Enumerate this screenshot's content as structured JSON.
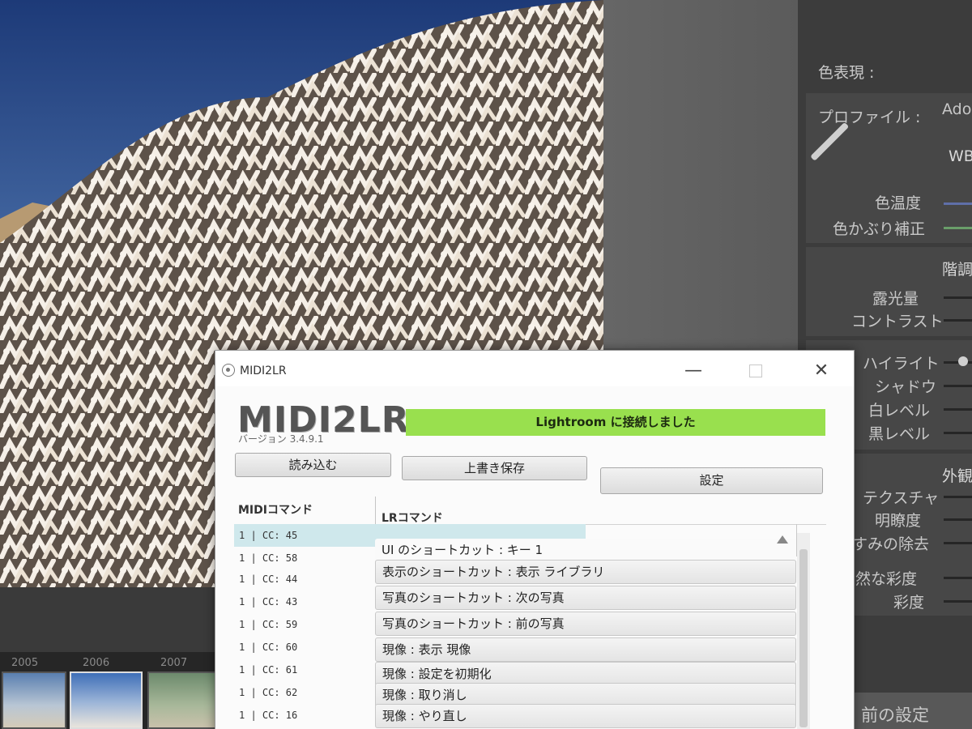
{
  "window": {
    "title": "MIDI2LR",
    "logo": "MIDI2LR",
    "version": "バージョン 3.4.9.1",
    "status": "Lightroom に接続しました",
    "minimize_glyph": "—",
    "close_glyph": "✕"
  },
  "buttons": {
    "load": "読み込む",
    "overwrite_save": "上書き保存",
    "settings": "設定"
  },
  "table": {
    "midi_header": "MIDIコマンド",
    "lr_header": "LRコマンド",
    "rows": [
      {
        "midi": "1 | CC: 45",
        "lr": "UI のショートカット : キー 1"
      },
      {
        "midi": "1 | CC: 58",
        "lr": "表示のショートカット : 表示 ライブラリ"
      },
      {
        "midi": "1 | CC: 44",
        "lr": "写真のショートカット : 次の写真"
      },
      {
        "midi": "1 | CC: 43",
        "lr": "写真のショートカット : 前の写真"
      },
      {
        "midi": "1 | CC: 59",
        "lr": "現像 : 表示 現像"
      },
      {
        "midi": "1 | CC: 60",
        "lr": "現像 : 設定を初期化"
      },
      {
        "midi": "1 | CC: 61",
        "lr": "現像 : 取り消し"
      },
      {
        "midi": "1 | CC: 62",
        "lr": "現像 : やり直し"
      },
      {
        "midi": "1 | CC: 16",
        "lr": ""
      }
    ]
  },
  "lightroom_panel": {
    "color_repr": "色表現 :",
    "profile": "プロファイル :",
    "profile_value": "Ado",
    "wb": "WB",
    "temp": "色温度",
    "tint": "色かぶり補正",
    "tone": "階調",
    "exposure": "露光量",
    "contrast": "コントラスト",
    "highlights": "ハイライト",
    "shadows": "シャドウ",
    "whites": "白レベル",
    "blacks": "黒レベル",
    "presence": "外観",
    "texture": "テクスチャ",
    "clarity": "明瞭度",
    "dehaze": "かすみの除去",
    "vibrance": "自然な彩度",
    "saturation": "彩度",
    "previous_settings": "前の設定"
  },
  "filmstrip": {
    "years": [
      "2005",
      "2006",
      "2007"
    ]
  },
  "colors": {
    "status_green": "#99e04e",
    "selected_row": "#cfe8ec",
    "panel_bg": "#3c3c3c"
  }
}
